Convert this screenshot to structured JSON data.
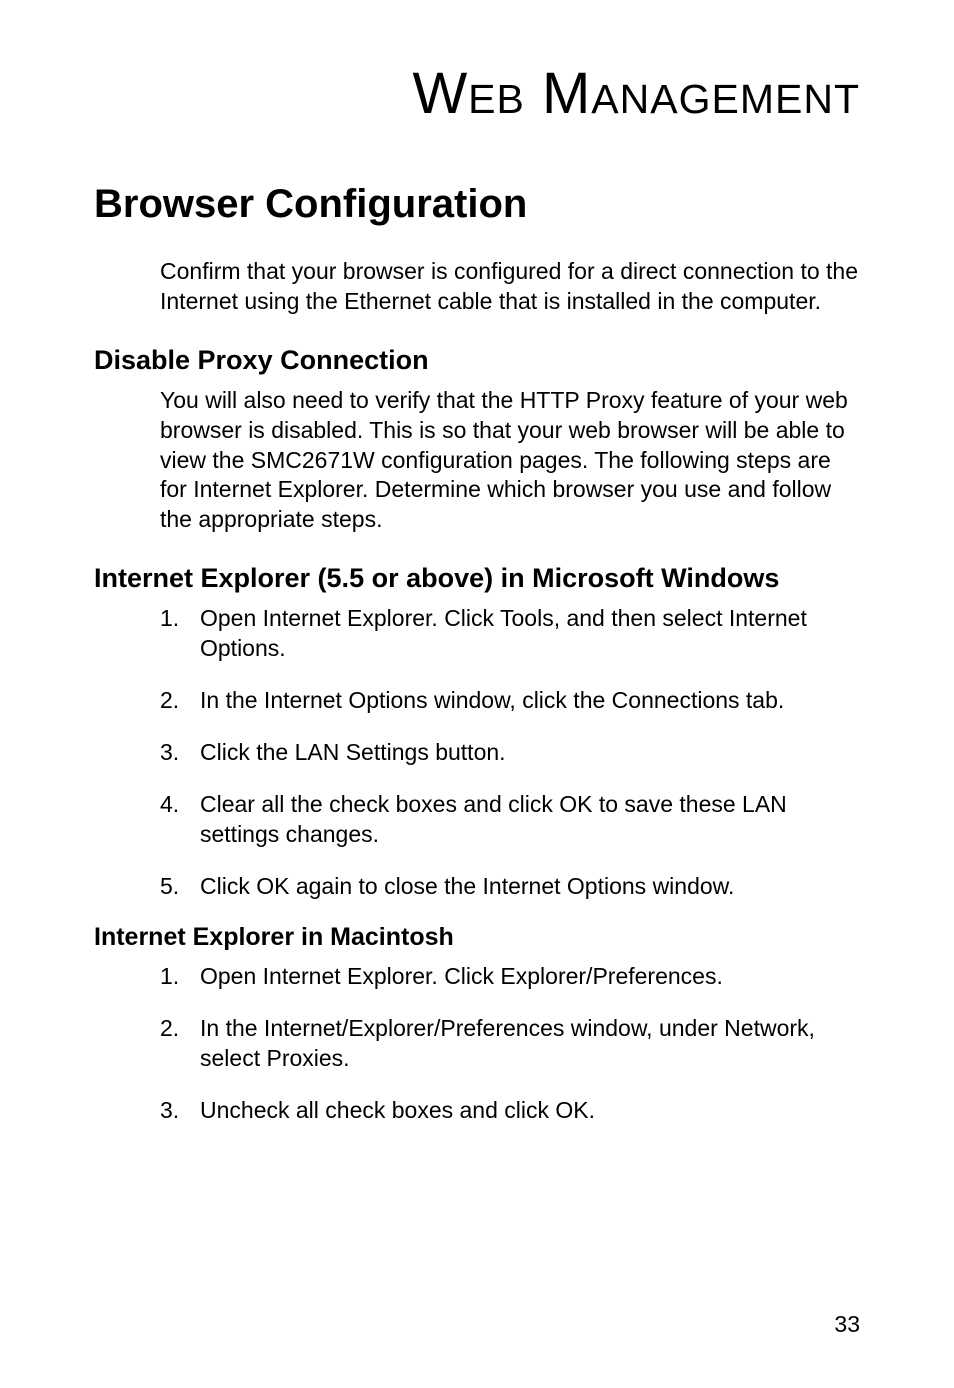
{
  "main_title": "Web Management",
  "section_title": "Browser Configuration",
  "intro": "Confirm that your browser is configured for a direct connection to the Internet using the Ethernet cable that is installed in the computer.",
  "disable_proxy": {
    "heading": "Disable Proxy Connection",
    "body": "You will also need to verify that the HTTP Proxy feature of your web browser is disabled. This is so that your web browser will be able to view the SMC2671W configuration pages. The following steps are for Internet Explorer. Determine which browser you use and follow the appropriate steps."
  },
  "ie_windows": {
    "heading": "Internet Explorer (5.5 or above) in Microsoft Windows",
    "items": [
      {
        "num": "1.",
        "text": "Open Internet Explorer. Click Tools, and then select Internet Options."
      },
      {
        "num": "2.",
        "text": "In the Internet Options window, click the Connections tab."
      },
      {
        "num": "3.",
        "text": "Click the LAN Settings button."
      },
      {
        "num": "4.",
        "text": "Clear all the check boxes and click OK to save these LAN settings changes."
      },
      {
        "num": "5.",
        "text": "Click OK again to close the Internet Options window."
      }
    ]
  },
  "ie_mac": {
    "heading": "Internet Explorer in Macintosh",
    "items": [
      {
        "num": "1.",
        "text": "Open Internet Explorer. Click Explorer/Preferences."
      },
      {
        "num": "2.",
        "text": "In the Internet/Explorer/Preferences window, under Network, select Proxies."
      },
      {
        "num": "3.",
        "text": "Uncheck all check boxes and click OK."
      }
    ]
  },
  "page_number": "33"
}
